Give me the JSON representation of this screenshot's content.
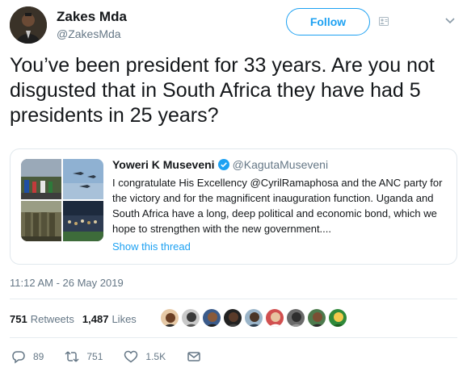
{
  "author": {
    "name": "Zakes Mda",
    "handle": "@ZakesMda",
    "follow_label": "Follow"
  },
  "tweet": {
    "text": "You’ve been president for 33 years. Are you not disgusted that in South Africa they have had 5 presidents in 25 years?",
    "timestamp": "11:12 AM - 26 May 2019"
  },
  "quoted": {
    "name": "Yoweri K Museveni",
    "handle": "@KagutaMuseveni",
    "text": "I congratulate His Excellency @CyrilRamaphosa and the ANC party for the victory and for the magnificent inauguration function. Uganda and South Africa have a long, deep political and economic bond, which we hope to strengthen with the new government....",
    "show_thread": "Show this thread"
  },
  "stats": {
    "retweets_count": "751",
    "retweets_label": "Retweets",
    "likes_count": "1,487",
    "likes_label": "Likes"
  },
  "actions": {
    "replies": "89",
    "retweets": "751",
    "likes": "1.5K"
  },
  "colors": {
    "accent": "#1da1f2",
    "text": "#14171a",
    "muted": "#657786",
    "border": "#e1e8ed"
  },
  "icons": [
    "followers-icon",
    "chevron-down-icon",
    "verified-badge-icon",
    "reply-icon",
    "retweet-icon",
    "like-icon",
    "direct-message-icon"
  ]
}
